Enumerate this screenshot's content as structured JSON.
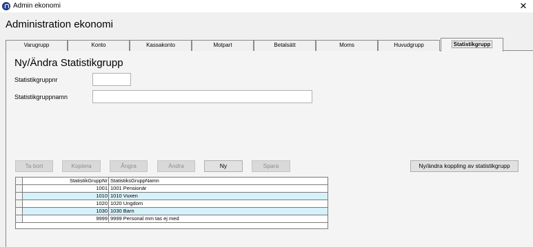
{
  "window": {
    "title": "Admin ekonomi",
    "close_glyph": "✕"
  },
  "page_title": "Administration ekonomi",
  "tabs": [
    {
      "label": "Varugrupp",
      "active": false
    },
    {
      "label": "Konto",
      "active": false
    },
    {
      "label": "Kassakonto",
      "active": false
    },
    {
      "label": "Motpart",
      "active": false
    },
    {
      "label": "Betalsätt",
      "active": false
    },
    {
      "label": "Moms",
      "active": false
    },
    {
      "label": "Huvudgrupp",
      "active": false
    },
    {
      "label": "Statistikgrupp",
      "active": true
    }
  ],
  "form": {
    "heading": "Ny/Ändra Statistikgrupp",
    "nr_label": "Statistikgruppnr",
    "nr_value": "",
    "name_label": "Statistikgruppnamn",
    "name_value": ""
  },
  "buttons": {
    "delete": "Ta bort",
    "copy": "Kopiera",
    "undo": "Ångra",
    "edit": "Ändra",
    "new": "Ny",
    "save": "Spara",
    "link": "Ny/ändra koppling av statistikgrupp"
  },
  "table": {
    "columns": [
      "StatistikGruppNr",
      "StatistiksGruppNamn"
    ],
    "rows": [
      {
        "nr": "1001",
        "name": "1001 Pensionär"
      },
      {
        "nr": "1010",
        "name": "1010 Vuxen"
      },
      {
        "nr": "1020",
        "name": "1020 Ungdom"
      },
      {
        "nr": "1030",
        "name": "1030 Barn"
      },
      {
        "nr": "9999",
        "name": "9999 Personal mm tas ej med"
      }
    ]
  }
}
